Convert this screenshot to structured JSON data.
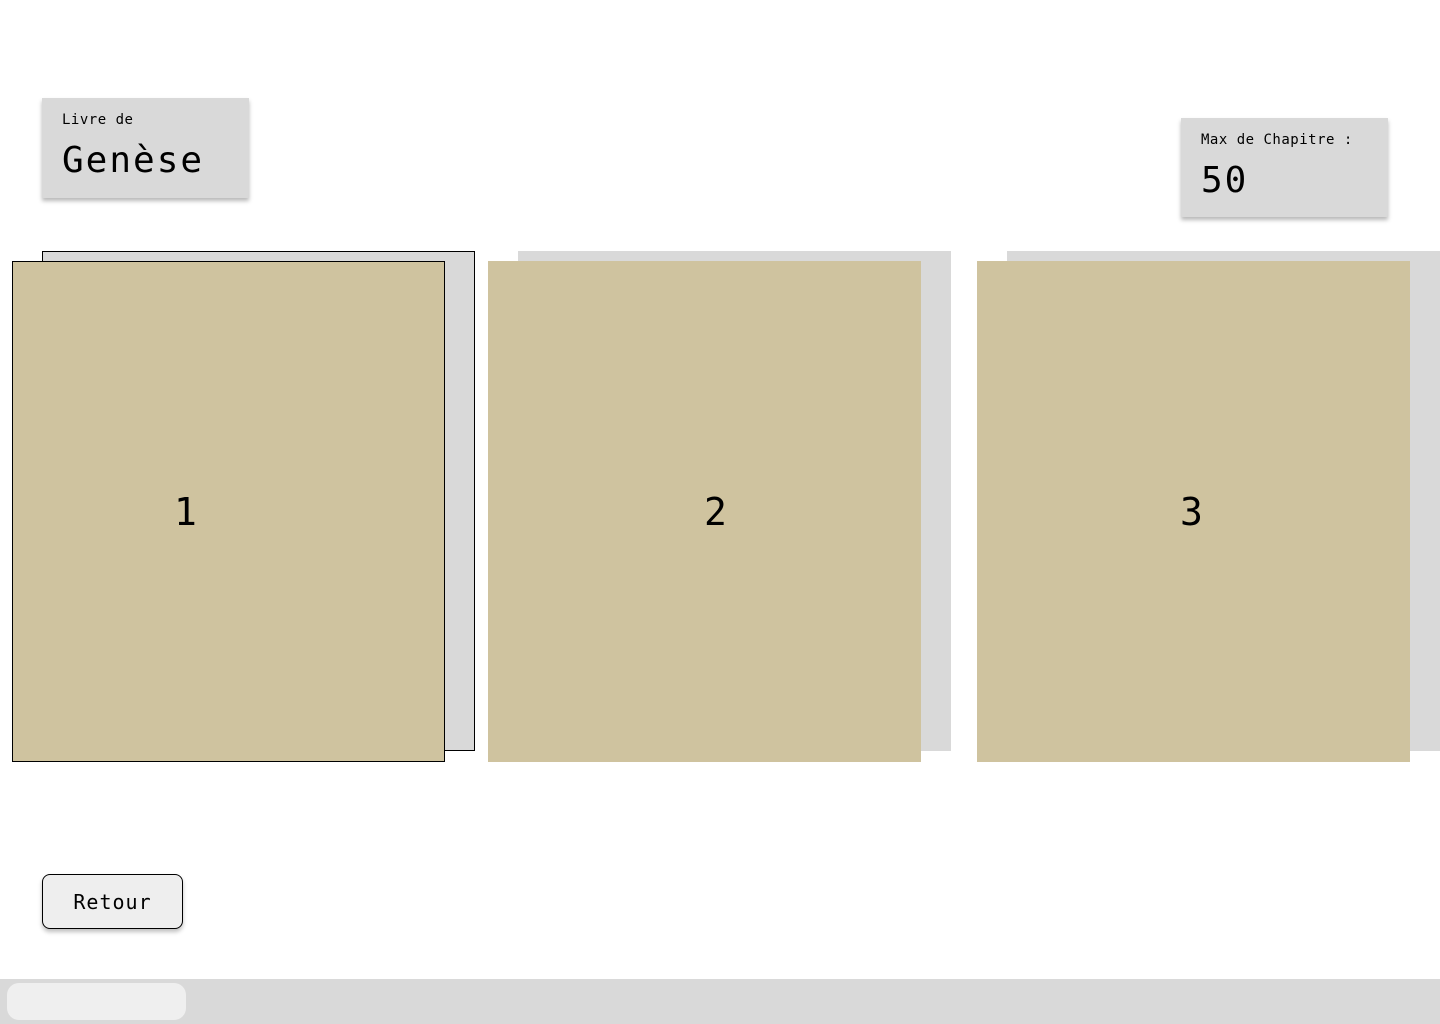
{
  "book": {
    "caption": "Livre de",
    "name": "Genèse"
  },
  "max_chapter": {
    "caption": "Max de Chapitre :",
    "value": "50"
  },
  "chapters": [
    {
      "label": "1",
      "selected": true
    },
    {
      "label": "2",
      "selected": false
    },
    {
      "label": "3",
      "selected": false
    }
  ],
  "actions": {
    "back_label": "Retour"
  },
  "colors": {
    "card_front": "#cfc39f",
    "card_back": "#d9d9d9",
    "panel": "#d9d9d9",
    "button": "#eeeeee"
  }
}
